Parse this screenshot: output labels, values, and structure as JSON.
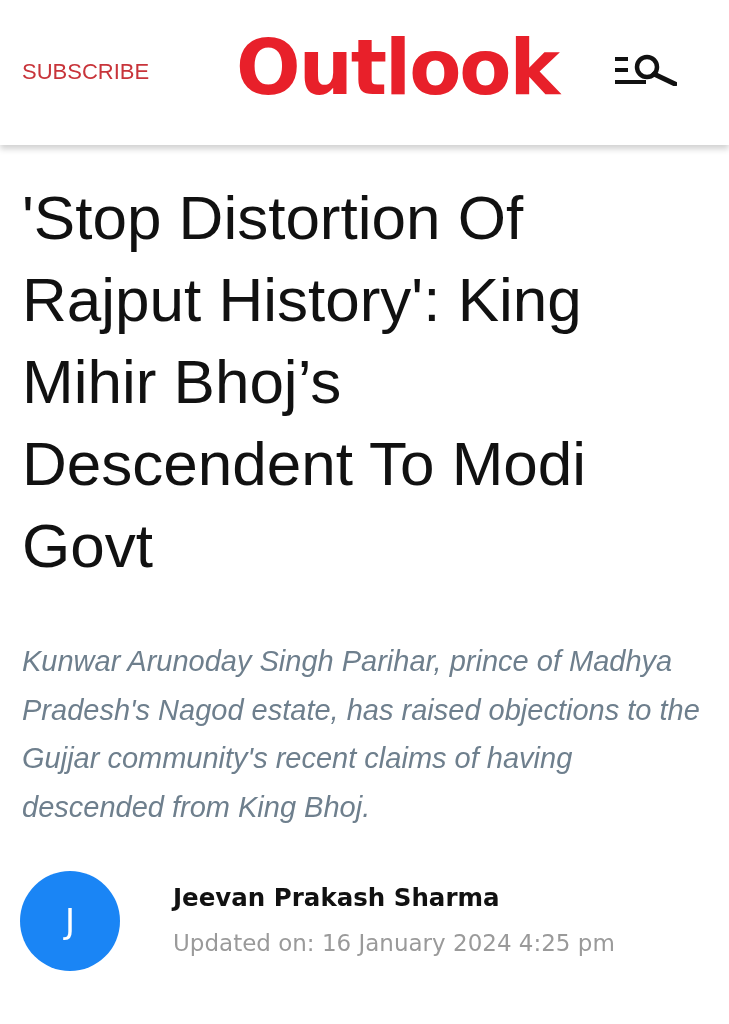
{
  "header": {
    "subscribe": "SUBSCRIBE",
    "logo": "Outlook"
  },
  "article": {
    "headline": "'Stop Distortion Of Rajput History': King Mihir Bhoj’s Descendent To Modi Govt",
    "summary": "Kunwar Arunoday Singh Parihar, prince of Madhya Pradesh's Nagod estate, has raised objections to the Gujjar community's recent claims of having descended from King Bhoj.",
    "author": {
      "initial": "J",
      "name": "Jeevan Prakash Sharma",
      "updated": "Updated on: 16 January 2024 4:25 pm"
    }
  }
}
